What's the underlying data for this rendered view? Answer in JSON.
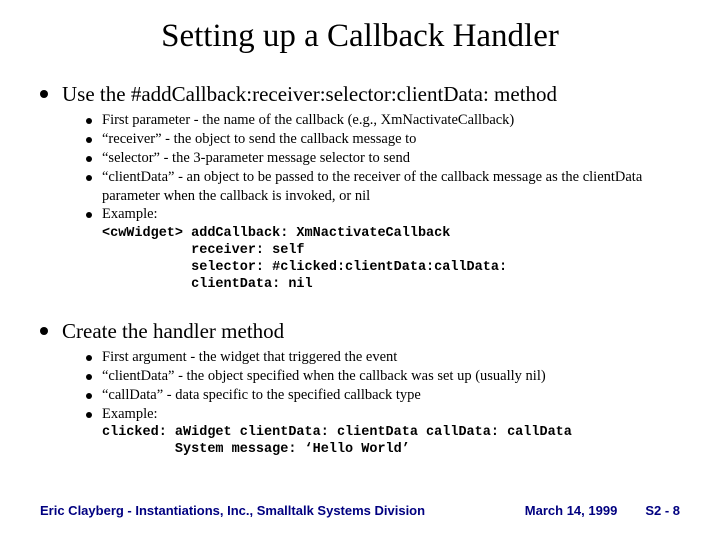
{
  "title": "Setting up a Callback Handler",
  "section1": {
    "heading": "Use the #addCallback:receiver:selector:clientData: method",
    "items": [
      "First parameter - the name of the callback (e.g., XmNactivateCallback)",
      "“receiver” - the object to send the callback message to",
      "“selector” - the 3-parameter message selector to send",
      "“clientData” - an object to be passed to the receiver of the callback message as the clientData parameter when the callback is invoked, or nil",
      "Example:"
    ],
    "code": "<cwWidget> addCallback: XmNactivateCallback\n           receiver: self\n           selector: #clicked:clientData:callData:\n           clientData: nil"
  },
  "section2": {
    "heading": "Create the handler method",
    "items": [
      "First argument - the widget that triggered the event",
      "“clientData” - the object specified when the callback was set up (usually nil)",
      "“callData” - data specific to the specified callback type",
      "Example:"
    ],
    "code": "clicked: aWidget clientData: clientData callData: callData\n         System message: ‘Hello World’"
  },
  "footer": {
    "left": "Eric Clayberg - Instantiations, Inc., Smalltalk Systems Division",
    "date": "March 14, 1999",
    "page": "S2 - 8"
  }
}
